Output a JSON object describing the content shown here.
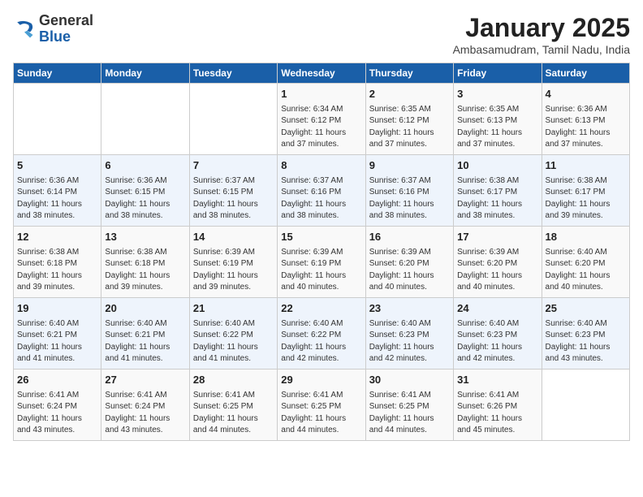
{
  "logo": {
    "general": "General",
    "blue": "Blue"
  },
  "header": {
    "month_year": "January 2025",
    "location": "Ambasamudram, Tamil Nadu, India"
  },
  "weekdays": [
    "Sunday",
    "Monday",
    "Tuesday",
    "Wednesday",
    "Thursday",
    "Friday",
    "Saturday"
  ],
  "weeks": [
    [
      {
        "day": "",
        "text": ""
      },
      {
        "day": "",
        "text": ""
      },
      {
        "day": "",
        "text": ""
      },
      {
        "day": "1",
        "text": "Sunrise: 6:34 AM\nSunset: 6:12 PM\nDaylight: 11 hours\nand 37 minutes."
      },
      {
        "day": "2",
        "text": "Sunrise: 6:35 AM\nSunset: 6:12 PM\nDaylight: 11 hours\nand 37 minutes."
      },
      {
        "day": "3",
        "text": "Sunrise: 6:35 AM\nSunset: 6:13 PM\nDaylight: 11 hours\nand 37 minutes."
      },
      {
        "day": "4",
        "text": "Sunrise: 6:36 AM\nSunset: 6:13 PM\nDaylight: 11 hours\nand 37 minutes."
      }
    ],
    [
      {
        "day": "5",
        "text": "Sunrise: 6:36 AM\nSunset: 6:14 PM\nDaylight: 11 hours\nand 38 minutes."
      },
      {
        "day": "6",
        "text": "Sunrise: 6:36 AM\nSunset: 6:15 PM\nDaylight: 11 hours\nand 38 minutes."
      },
      {
        "day": "7",
        "text": "Sunrise: 6:37 AM\nSunset: 6:15 PM\nDaylight: 11 hours\nand 38 minutes."
      },
      {
        "day": "8",
        "text": "Sunrise: 6:37 AM\nSunset: 6:16 PM\nDaylight: 11 hours\nand 38 minutes."
      },
      {
        "day": "9",
        "text": "Sunrise: 6:37 AM\nSunset: 6:16 PM\nDaylight: 11 hours\nand 38 minutes."
      },
      {
        "day": "10",
        "text": "Sunrise: 6:38 AM\nSunset: 6:17 PM\nDaylight: 11 hours\nand 38 minutes."
      },
      {
        "day": "11",
        "text": "Sunrise: 6:38 AM\nSunset: 6:17 PM\nDaylight: 11 hours\nand 39 minutes."
      }
    ],
    [
      {
        "day": "12",
        "text": "Sunrise: 6:38 AM\nSunset: 6:18 PM\nDaylight: 11 hours\nand 39 minutes."
      },
      {
        "day": "13",
        "text": "Sunrise: 6:38 AM\nSunset: 6:18 PM\nDaylight: 11 hours\nand 39 minutes."
      },
      {
        "day": "14",
        "text": "Sunrise: 6:39 AM\nSunset: 6:19 PM\nDaylight: 11 hours\nand 39 minutes."
      },
      {
        "day": "15",
        "text": "Sunrise: 6:39 AM\nSunset: 6:19 PM\nDaylight: 11 hours\nand 40 minutes."
      },
      {
        "day": "16",
        "text": "Sunrise: 6:39 AM\nSunset: 6:20 PM\nDaylight: 11 hours\nand 40 minutes."
      },
      {
        "day": "17",
        "text": "Sunrise: 6:39 AM\nSunset: 6:20 PM\nDaylight: 11 hours\nand 40 minutes."
      },
      {
        "day": "18",
        "text": "Sunrise: 6:40 AM\nSunset: 6:20 PM\nDaylight: 11 hours\nand 40 minutes."
      }
    ],
    [
      {
        "day": "19",
        "text": "Sunrise: 6:40 AM\nSunset: 6:21 PM\nDaylight: 11 hours\nand 41 minutes."
      },
      {
        "day": "20",
        "text": "Sunrise: 6:40 AM\nSunset: 6:21 PM\nDaylight: 11 hours\nand 41 minutes."
      },
      {
        "day": "21",
        "text": "Sunrise: 6:40 AM\nSunset: 6:22 PM\nDaylight: 11 hours\nand 41 minutes."
      },
      {
        "day": "22",
        "text": "Sunrise: 6:40 AM\nSunset: 6:22 PM\nDaylight: 11 hours\nand 42 minutes."
      },
      {
        "day": "23",
        "text": "Sunrise: 6:40 AM\nSunset: 6:23 PM\nDaylight: 11 hours\nand 42 minutes."
      },
      {
        "day": "24",
        "text": "Sunrise: 6:40 AM\nSunset: 6:23 PM\nDaylight: 11 hours\nand 42 minutes."
      },
      {
        "day": "25",
        "text": "Sunrise: 6:40 AM\nSunset: 6:23 PM\nDaylight: 11 hours\nand 43 minutes."
      }
    ],
    [
      {
        "day": "26",
        "text": "Sunrise: 6:41 AM\nSunset: 6:24 PM\nDaylight: 11 hours\nand 43 minutes."
      },
      {
        "day": "27",
        "text": "Sunrise: 6:41 AM\nSunset: 6:24 PM\nDaylight: 11 hours\nand 43 minutes."
      },
      {
        "day": "28",
        "text": "Sunrise: 6:41 AM\nSunset: 6:25 PM\nDaylight: 11 hours\nand 44 minutes."
      },
      {
        "day": "29",
        "text": "Sunrise: 6:41 AM\nSunset: 6:25 PM\nDaylight: 11 hours\nand 44 minutes."
      },
      {
        "day": "30",
        "text": "Sunrise: 6:41 AM\nSunset: 6:25 PM\nDaylight: 11 hours\nand 44 minutes."
      },
      {
        "day": "31",
        "text": "Sunrise: 6:41 AM\nSunset: 6:26 PM\nDaylight: 11 hours\nand 45 minutes."
      },
      {
        "day": "",
        "text": ""
      }
    ]
  ]
}
